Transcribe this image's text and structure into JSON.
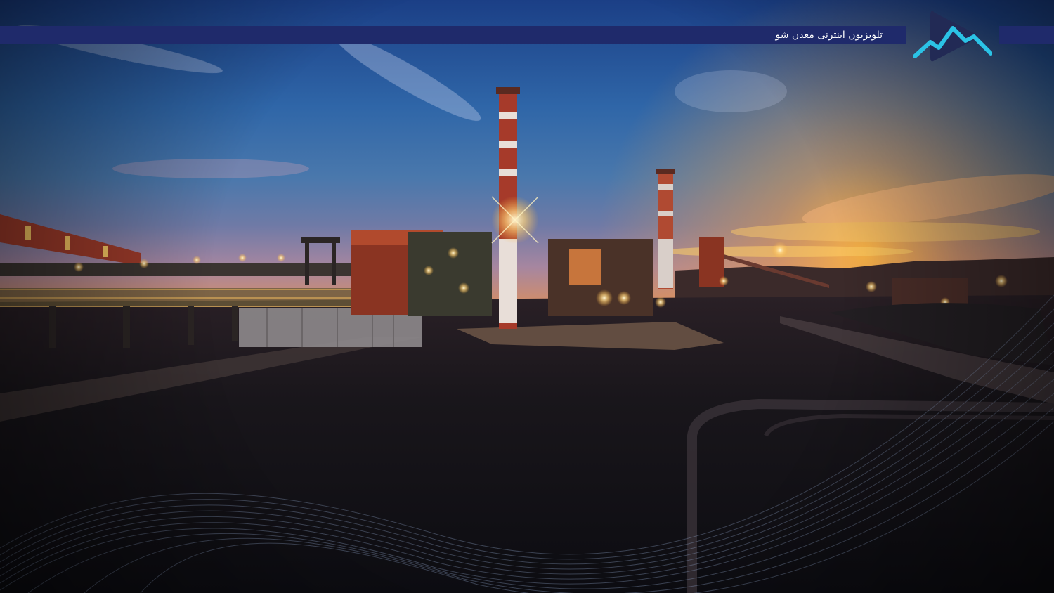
{
  "banner": {
    "title": "تلویزیون اینترنی معدن شو",
    "bar_color": "#1f2a6b"
  },
  "logo": {
    "icon": "play-mountain-logo-icon",
    "play_color": "#222a55",
    "mountain_color": "#2bc3e6"
  },
  "scene": {
    "description_icon": "industrial-plant-sunset-photo"
  }
}
